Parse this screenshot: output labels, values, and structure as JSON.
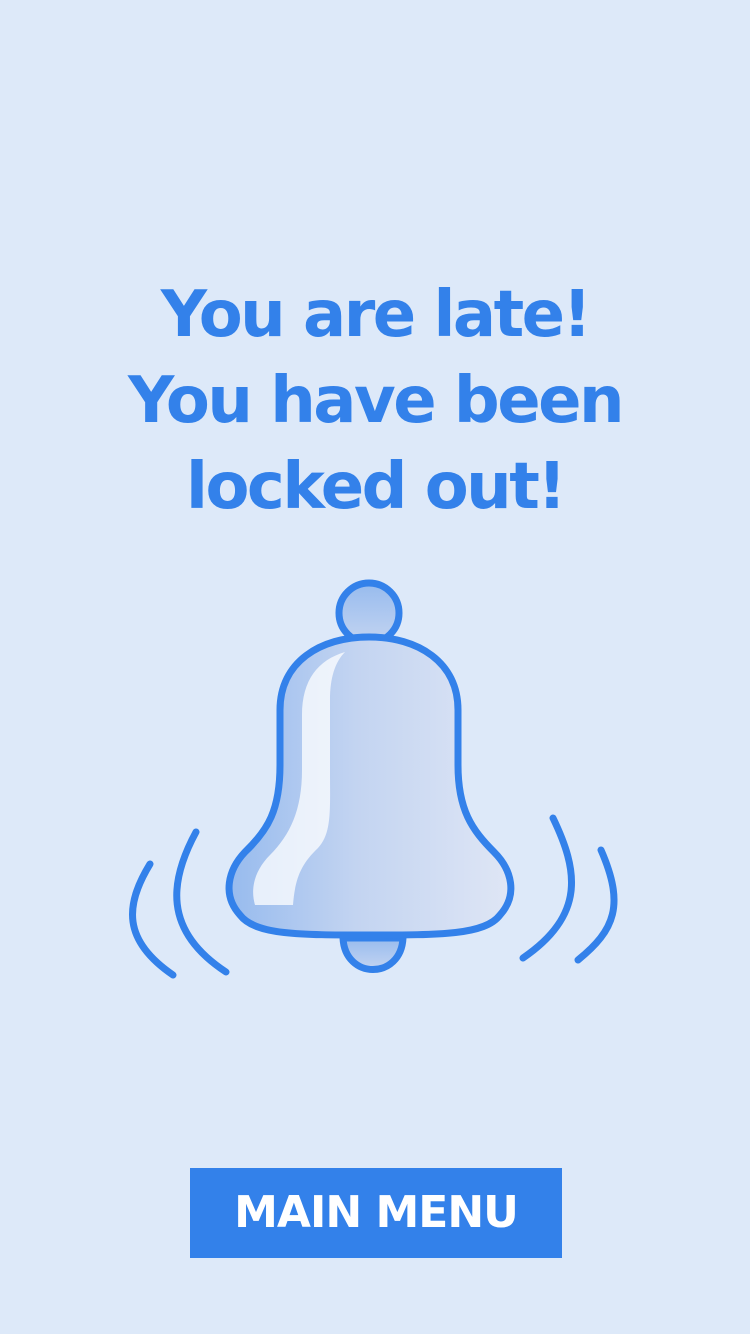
{
  "colors": {
    "background": "#dde9f9",
    "accent": "#3381ea",
    "button_text": "#ffffff",
    "bell_light": "#dfe6f5",
    "bell_mid": "#c3d4f1",
    "bell_dark": "#97bbee"
  },
  "message": {
    "line1": "You are late!",
    "line2": "You have been",
    "line3": "locked out!"
  },
  "illustration": {
    "icon": "ringing-bell-icon"
  },
  "button": {
    "label": "MAIN MENU"
  }
}
